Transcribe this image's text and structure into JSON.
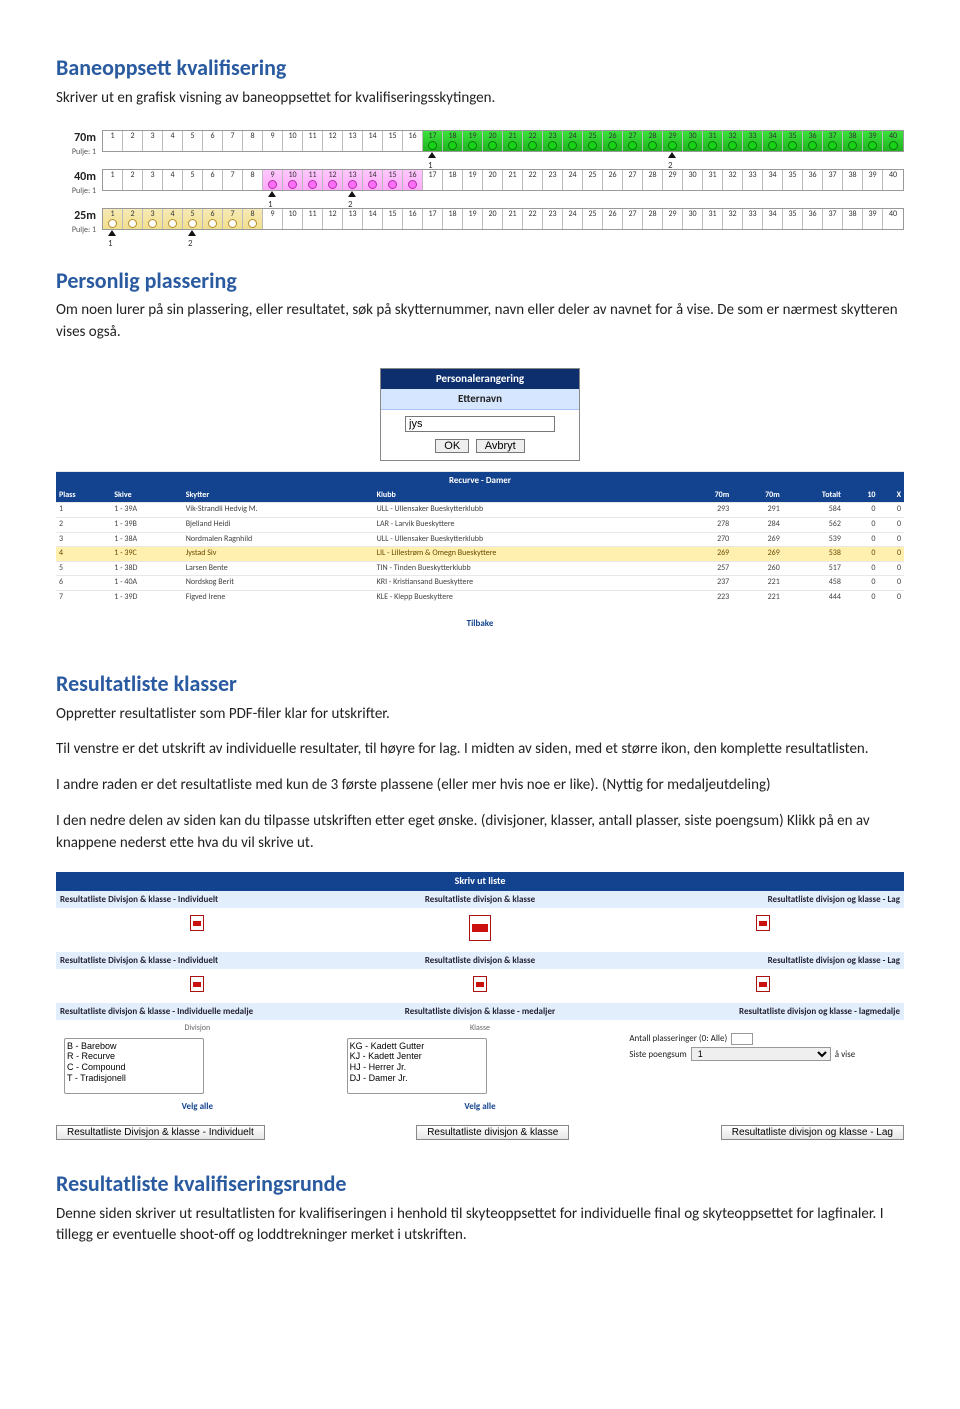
{
  "sections": {
    "baneoppsett": {
      "title": "Baneoppsett kvalifisering",
      "text": "Skriver ut en grafisk visning av baneoppsettet for kvalifiseringsskytingen."
    },
    "personlig": {
      "title": "Personlig plassering",
      "text": "Om noen lurer på sin plassering, eller resultatet, søk på skytternummer, navn eller deler av navnet for å vise. De som er nærmest skytteren vises også."
    },
    "resultatliste": {
      "title": "Resultatliste klasser",
      "p1": "Oppretter resultatlister som PDF-filer klar for utskrifter.",
      "p2": "Til venstre er det utskrift av individuelle resultater, til høyre for lag. I midten av siden, med et større ikon, den komplette resultatlisten.",
      "p3": "I andre raden er det resultatliste med kun de 3 første plassene (eller mer hvis noe er like). (Nyttig for medaljeutdeling)",
      "p4": "I den nedre delen av siden kan du tilpasse utskriften etter eget ønske. (divisjoner, klasser, antall plasser, siste poengsum) Klikk på en av knappene nederst ette hva du vil skrive ut."
    },
    "kvalrunde": {
      "title": "Resultatliste kvalifiseringsrunde",
      "text": "Denne siden skriver ut resultatlisten for kvalifiseringen i henhold til skyteoppsettet for individuelle final og skyteoppsettet for lagfinaler. I tillegg er eventuelle shoot-off og loddtrekninger merket i utskriften."
    }
  },
  "lanes": {
    "columns": [
      "1",
      "2",
      "3",
      "4",
      "5",
      "6",
      "7",
      "8",
      "9",
      "10",
      "11",
      "12",
      "13",
      "14",
      "15",
      "16",
      "17",
      "18",
      "19",
      "20",
      "21",
      "22",
      "23",
      "24",
      "25",
      "26",
      "27",
      "28",
      "29",
      "30",
      "31",
      "32",
      "33",
      "34",
      "35",
      "36",
      "37",
      "38",
      "39",
      "40"
    ],
    "rows": [
      {
        "dist": "70m",
        "pulje": "Pulje: 1",
        "fill_start": 17,
        "fill_end": 40,
        "style": "green",
        "markers": [
          {
            "at": 17,
            "label": "1"
          },
          {
            "at": 29,
            "label": "2"
          }
        ]
      },
      {
        "dist": "40m",
        "pulje": "Pulje: 1",
        "fill_start": 9,
        "fill_end": 16,
        "style": "pink",
        "markers": [
          {
            "at": 9,
            "label": "1"
          },
          {
            "at": 13,
            "label": "2"
          }
        ]
      },
      {
        "dist": "25m",
        "pulje": "Pulje: 1",
        "fill_start": 1,
        "fill_end": 8,
        "style": "tan",
        "markers": [
          {
            "at": 1,
            "label": "1"
          },
          {
            "at": 5,
            "label": "2"
          }
        ]
      }
    ]
  },
  "search_dialog": {
    "header": "Personalerangering",
    "field_label": "Etternavn",
    "value": "jys",
    "ok": "OK",
    "cancel": "Avbryt"
  },
  "rec_table": {
    "caption": "Recurve - Damer",
    "cols": [
      "Plass",
      "Skive",
      "Skytter",
      "Klubb",
      "70m",
      "70m",
      "Totalt",
      "10",
      "X"
    ],
    "rows": [
      [
        "1",
        "1 - 39A",
        "Vik-Strandli Hedvig M.",
        "ULL - Ullensaker Bueskytterklubb",
        "293",
        "291",
        "584",
        "0",
        "0"
      ],
      [
        "2",
        "1 - 39B",
        "Bjelland Heidi",
        "LAR - Larvik Bueskyttere",
        "278",
        "284",
        "562",
        "0",
        "0"
      ],
      [
        "3",
        "1 - 38A",
        "Nordmalen Ragnhild",
        "ULL - Ullensaker Bueskytterklubb",
        "270",
        "269",
        "539",
        "0",
        "0"
      ],
      [
        "4",
        "1 - 39C",
        "Jystad Siv",
        "LIL - Lillestrøm & Omegn Bueskyttere",
        "269",
        "269",
        "538",
        "0",
        "0"
      ],
      [
        "5",
        "1 - 38D",
        "Larsen Bente",
        "TIN - Tinden Bueskytterklubb",
        "257",
        "260",
        "517",
        "0",
        "0"
      ],
      [
        "6",
        "1 - 40A",
        "Nordskog Berit",
        "KRI - Kristiansand Bueskyttere",
        "237",
        "221",
        "458",
        "0",
        "0"
      ],
      [
        "7",
        "1 - 39D",
        "Figved Irene",
        "KLE - Klepp Bueskyttere",
        "223",
        "221",
        "444",
        "0",
        "0"
      ]
    ],
    "hl_row": 3,
    "tilbake": "Tilbake"
  },
  "print": {
    "header": "Skriv ut liste",
    "row1": {
      "l": "Resultatliste Divisjon & klasse - Individuelt",
      "c": "Resultatliste divisjon & klasse",
      "r": "Resultatliste divisjon og klasse - Lag"
    },
    "row2": {
      "l": "Resultatliste Divisjon & klasse - Individuelt",
      "c": "Resultatliste divisjon & klasse",
      "r": "Resultatliste divisjon og klasse - Lag"
    },
    "row3": {
      "l": "Resultatliste divisjon & klasse - Individuelle medalje",
      "c": "Resultatliste divisjon & klasse - medaljer",
      "r": "Resultatliste divisjon og klasse - lagmedalje"
    },
    "divisjon_label": "Divisjon",
    "divisjoner": [
      "B - Barebow",
      "R - Recurve",
      "C - Compound",
      "T - Tradisjonell"
    ],
    "klasse_label": "Klasse",
    "klasser": [
      "KG - Kadett Gutter",
      "KJ - Kadett Jenter",
      "HJ - Herrer Jr.",
      "DJ - Damer Jr."
    ],
    "velg_alle": "Velg alle",
    "antall_label": "Antall plasseringer (0: Alle)",
    "antall_value": "",
    "siste_label_a": "Siste poengsum",
    "siste_label_b": "å vise",
    "siste_value": "1",
    "buttons": {
      "l": "Resultatliste Divisjon & klasse - Individuelt",
      "c": "Resultatliste divisjon & klasse",
      "r": "Resultatliste divisjon og klasse - Lag"
    }
  }
}
